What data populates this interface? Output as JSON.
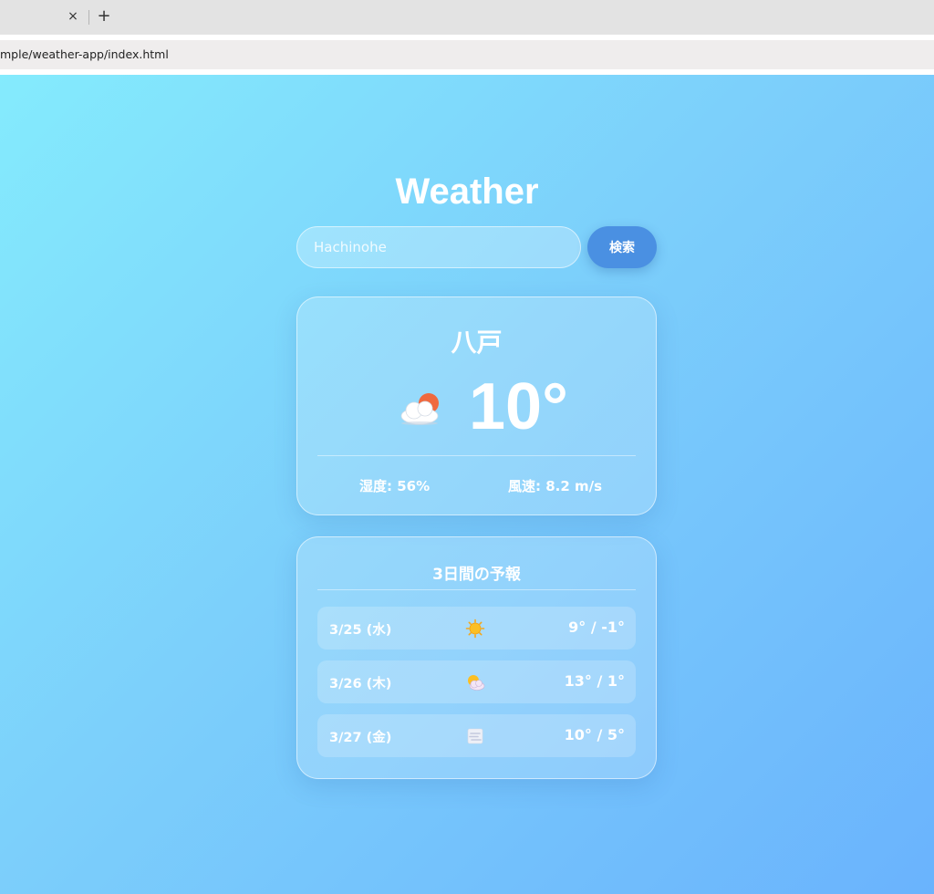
{
  "browser": {
    "tab_close": "×",
    "new_tab": "+",
    "url": "mple/weather-app/index.html"
  },
  "app": {
    "title": "Weather",
    "search": {
      "value": "",
      "placeholder": "Hachinohe",
      "button_label": "検索"
    }
  },
  "current": {
    "city": "八戸",
    "temp": "10°",
    "icon": "cloud-sun-icon",
    "humidity": "湿度: 56%",
    "wind": "風速: 8.2 m/s"
  },
  "forecast": {
    "title": "3日間の予報",
    "days": [
      {
        "date": "3/25 (水)",
        "icon": "sun-icon",
        "temp": "9° / -1°"
      },
      {
        "date": "3/26 (木)",
        "icon": "sun-behind-cloud-icon",
        "temp": "13° / 1°"
      },
      {
        "date": "3/27 (金)",
        "icon": "fog-icon",
        "temp": "10° / 5°"
      }
    ]
  },
  "colors": {
    "button": "#4a90e2",
    "bg_start": "#84ebfd",
    "bg_end": "#6ab3fd",
    "sun": "#f0693e"
  }
}
